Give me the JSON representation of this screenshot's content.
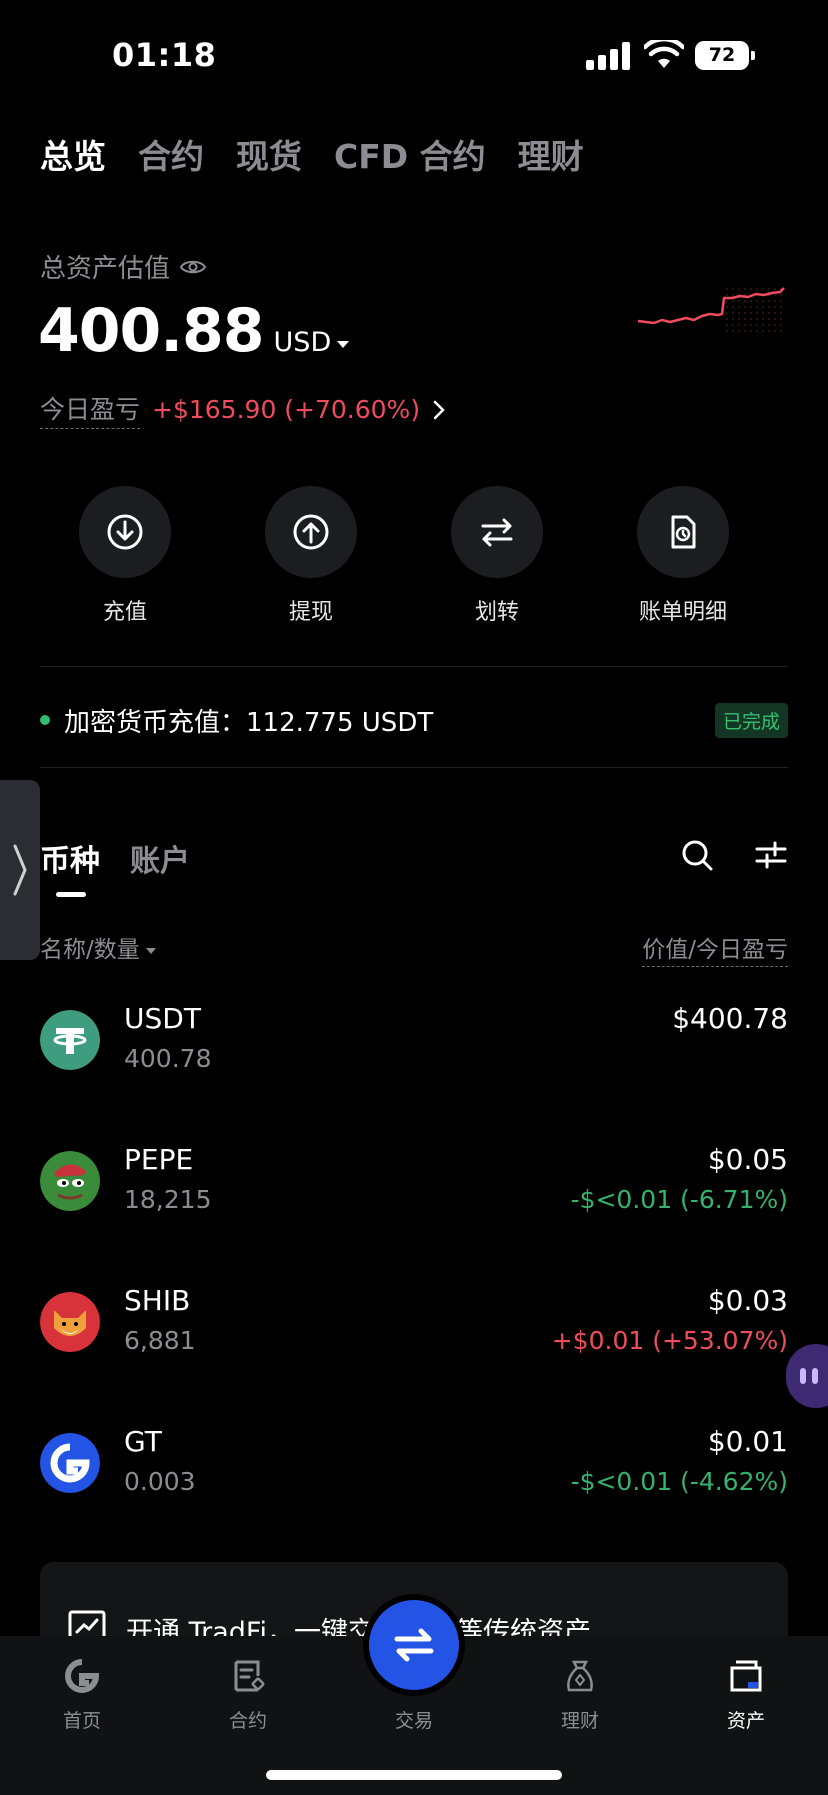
{
  "status_bar": {
    "time": "01:18",
    "battery": "72"
  },
  "top_tabs": [
    {
      "label": "总览",
      "active": true
    },
    {
      "label": "合约",
      "active": false
    },
    {
      "label": "现货",
      "active": false
    },
    {
      "label": "CFD 合约",
      "active": false
    },
    {
      "label": "理财",
      "active": false
    }
  ],
  "overview": {
    "total_label": "总资产估值",
    "total_value": "400.88",
    "currency": "USD",
    "pnl_label": "今日盈亏",
    "pnl_value": "+$165.90 (+70.60%)"
  },
  "actions": [
    {
      "label": "充值",
      "icon": "download-icon"
    },
    {
      "label": "提现",
      "icon": "upload-icon"
    },
    {
      "label": "划转",
      "icon": "transfer-icon"
    },
    {
      "label": "账单明细",
      "icon": "bill-icon"
    }
  ],
  "notice": {
    "text": "加密货币充值：112.775 USDT",
    "status": "已完成"
  },
  "list_tabs": [
    {
      "label": "币种",
      "active": true
    },
    {
      "label": "账户",
      "active": false
    }
  ],
  "list_header": {
    "left": "名称/数量",
    "right": "价值/今日盈亏"
  },
  "coins": [
    {
      "name": "USDT",
      "qty": "400.78",
      "value": "$400.78",
      "pnl": "",
      "pnl_sign": "none"
    },
    {
      "name": "PEPE",
      "qty": "18,215",
      "value": "$0.05",
      "pnl": "-$<0.01 (-6.71%)",
      "pnl_sign": "neg"
    },
    {
      "name": "SHIB",
      "qty": "6,881",
      "value": "$0.03",
      "pnl": "+$0.01 (+53.07%)",
      "pnl_sign": "pos"
    },
    {
      "name": "GT",
      "qty": "0.003",
      "value": "$0.01",
      "pnl": "-$<0.01 (-4.62%)",
      "pnl_sign": "neg"
    }
  ],
  "tradfi": {
    "text": "开通 TradFi，一键交易黄金等传统资产"
  },
  "bottom_nav": [
    {
      "label": "首页",
      "active": false
    },
    {
      "label": "合约",
      "active": false
    },
    {
      "label": "交易",
      "active": false
    },
    {
      "label": "理财",
      "active": false
    },
    {
      "label": "资产",
      "active": true
    }
  ],
  "colors": {
    "loss": "#36b26f",
    "profit": "#ef4c5e",
    "accent": "#2354e6"
  }
}
